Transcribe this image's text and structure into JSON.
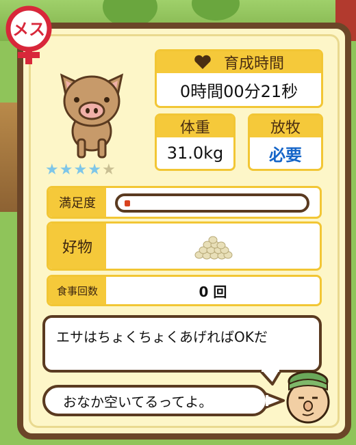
{
  "gender_badge": {
    "label": "メス",
    "color": "#d8273a"
  },
  "animal": {
    "icon": "pig-icon",
    "rating": 4,
    "max_rating": 5
  },
  "growth_time": {
    "label": "育成時間",
    "value": "0時間00分21秒",
    "icon": "heart-icon"
  },
  "weight": {
    "label": "体重",
    "value": "31.0kg"
  },
  "grazing": {
    "label": "放牧",
    "value": "必要",
    "value_color": "#1565c8"
  },
  "satisfaction": {
    "label": "満足度",
    "level": 0.03
  },
  "favorite": {
    "label": "好物",
    "icon": "beans-icon"
  },
  "meals": {
    "label": "食事回数",
    "value": "0 回"
  },
  "advice": {
    "text": "エサはちょくちょくあげればOKだ"
  },
  "speech": {
    "text": "おなか空いてるってよ。"
  },
  "npc": {
    "icon": "farmer-face-icon"
  }
}
